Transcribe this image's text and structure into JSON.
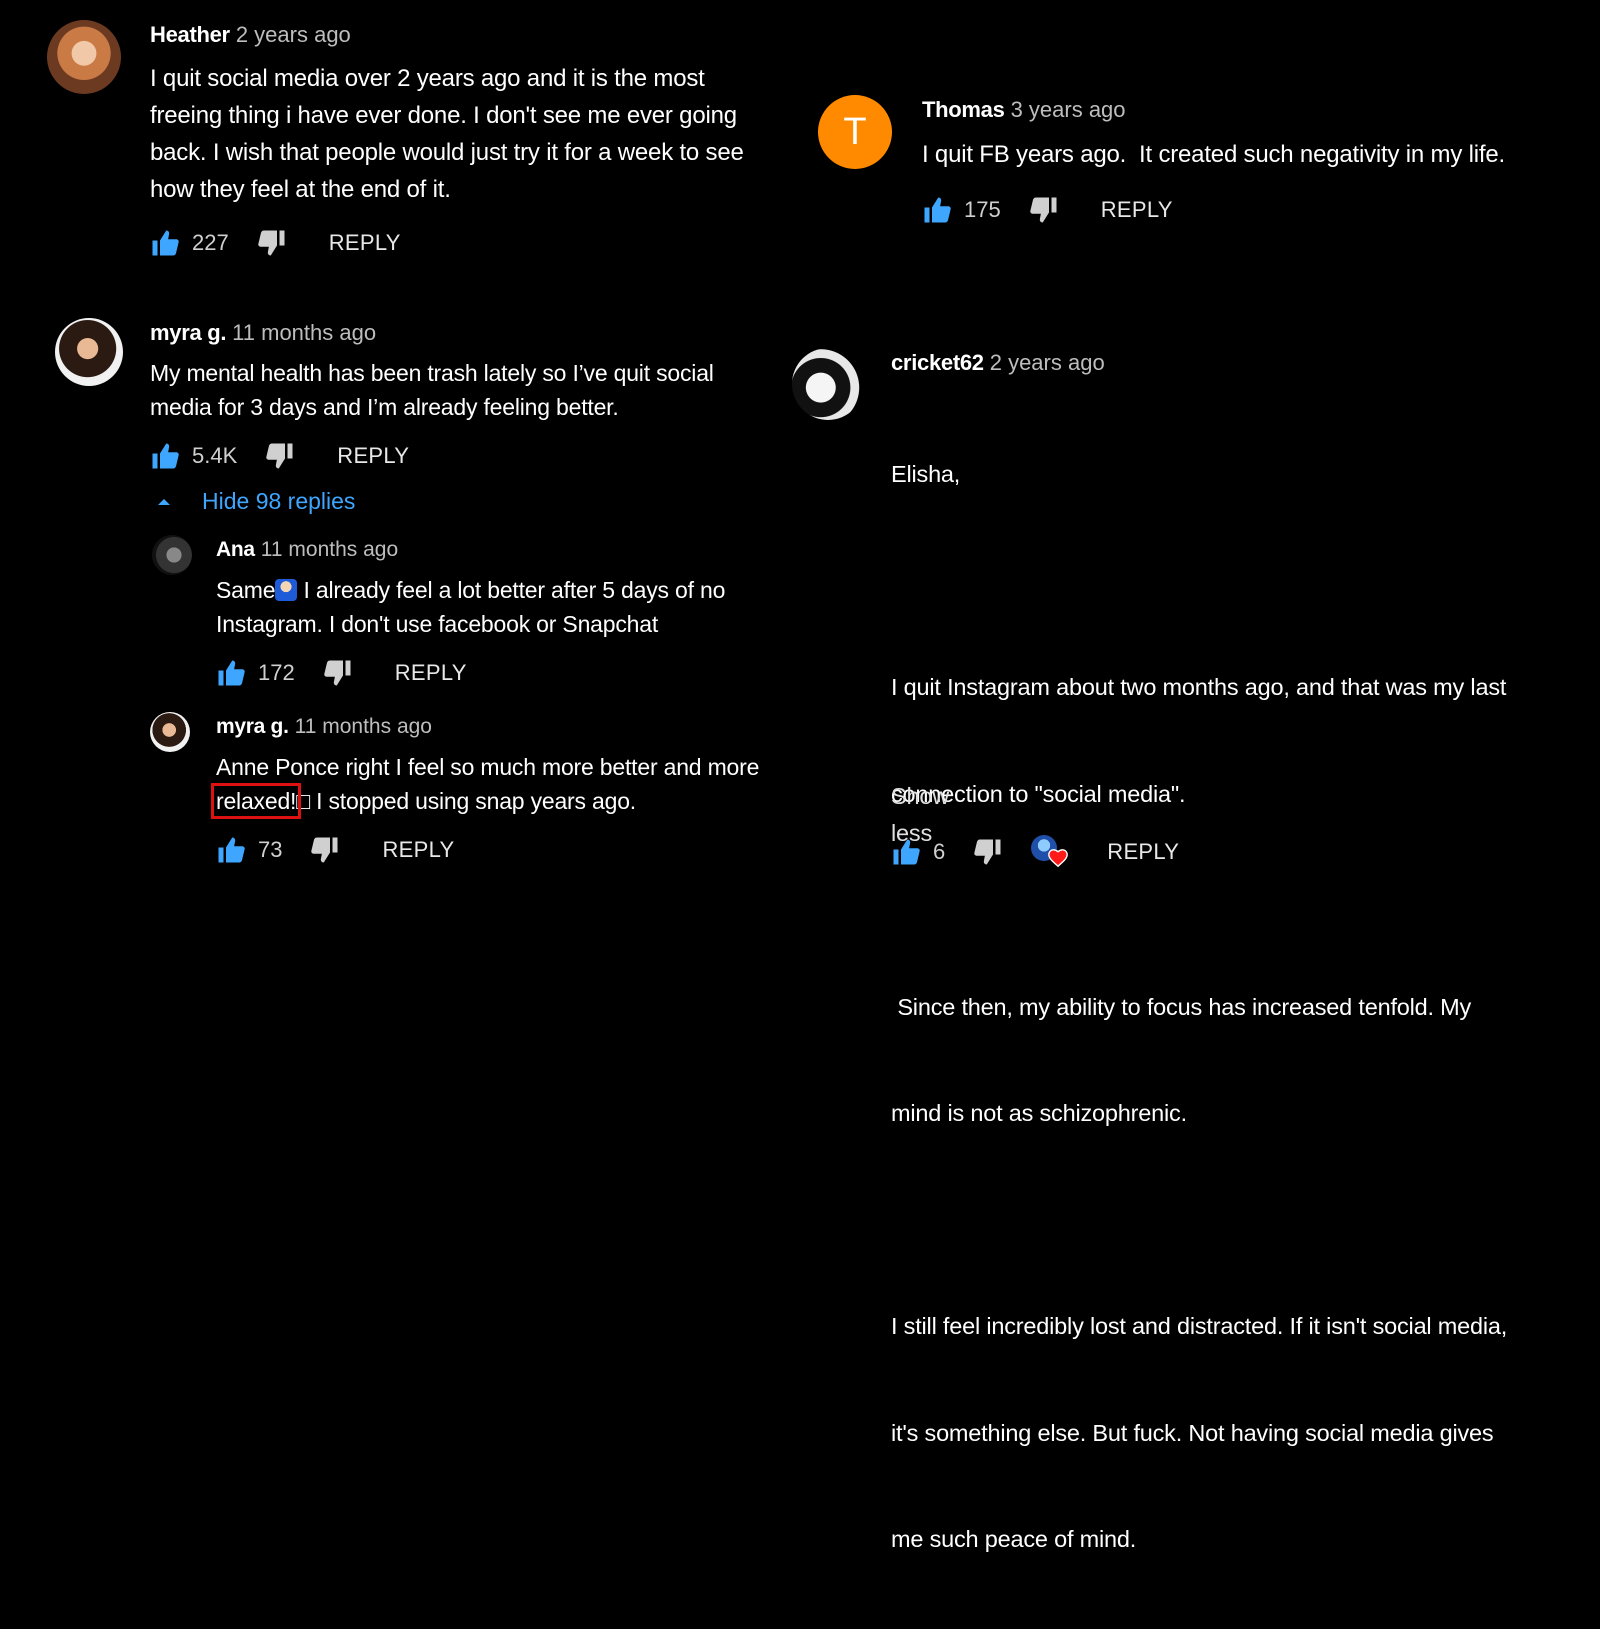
{
  "comments": {
    "heather": {
      "name": "Heather",
      "time": "2 years ago",
      "text_lines": [
        "I quit social media over 2 years ago and it is the most",
        "freeing thing i have ever done. I don't see me ever going",
        "back. I wish that people would just try it for a week to see",
        "how they feel at the end of it."
      ],
      "likes": "227",
      "reply": "REPLY"
    },
    "thomas": {
      "name": "Thomas",
      "time": "3 years ago",
      "avatar_letter": "T",
      "avatar_color": "#ff8a00",
      "text": "I quit FB years ago.  It created such negativity in my life.",
      "likes": "175",
      "reply": "REPLY"
    },
    "myra": {
      "name": "myra g.",
      "time": "11 months ago",
      "text_lines": [
        "My mental health has been trash lately so I’ve quit social",
        "media for 3 days and I’m already feeling better."
      ],
      "likes": "5.4K",
      "reply": "REPLY",
      "hide_replies": "Hide 98 replies"
    },
    "ana": {
      "name": "Ana",
      "time": "11 months ago",
      "text_line1_a": "Same",
      "text_line1_b": " I already feel a lot better after 5 days of no",
      "text_line2": "Instagram. I don't use facebook or Snapchat",
      "likes": "172",
      "reply": "REPLY"
    },
    "myra_reply": {
      "name": "myra g.",
      "time": "11 months ago",
      "text_line1": "Anne Ponce right I feel so much more better and more",
      "text_highlight": "relaxed!",
      "text_line2_rest": "□ I stopped using snap years ago.",
      "likes": "73",
      "reply": "REPLY"
    },
    "cricket": {
      "name": "cricket62",
      "time": "2 years ago",
      "lines": {
        "l1": "Elisha,",
        "l2": "I quit Instagram about two months ago, and that was my last",
        "l3": "connection to \"social media\".",
        "l4": " Since then, my ability to focus has increased tenfold. My",
        "l5": "mind is not as schizophrenic.",
        "l6": "I still feel incredibly lost and distracted. If it isn't social media,",
        "l7": "it's something else. But fuck. Not having social media gives",
        "l8": "me such peace of mind."
      },
      "show_less": "Show less",
      "likes": "6",
      "reply": "REPLY"
    }
  },
  "colors": {
    "background": "#000000",
    "like_blue": "#3ea6ff",
    "link_blue": "#3ea6ff",
    "highlight_red": "#dd1111",
    "heart_red": "#ff1a1a"
  },
  "icons": {
    "like": "thumbs-up-icon",
    "dislike": "thumbs-down-icon",
    "caret": "caret-up-icon",
    "creator_heart": "creator-heart-icon"
  }
}
